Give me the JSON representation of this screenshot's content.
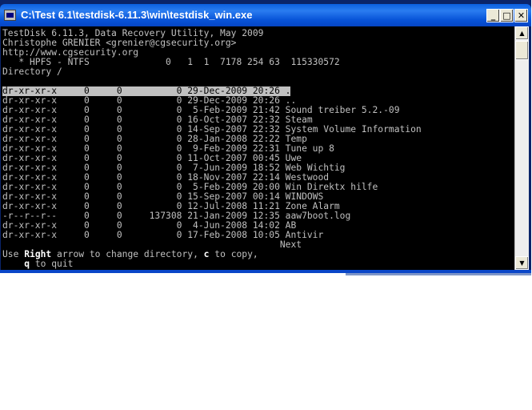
{
  "window": {
    "title": "C:\\Test 6.1\\testdisk-6.11.3\\win\\testdisk_win.exe",
    "controls": {
      "minimize": "_",
      "maximize": "□",
      "close": "✕"
    }
  },
  "console": {
    "header": [
      "TestDisk 6.11.3, Data Recovery Utility, May 2009",
      "Christophe GRENIER <grenier@cgsecurity.org>",
      "http://www.cgsecurity.org",
      "   * HPFS - NTFS              0   1  1  7178 254 63  115330572",
      "Directory /"
    ],
    "rows": [
      "dr-xr-xr-x     0     0          0 29-Dec-2009 20:26 .",
      "dr-xr-xr-x     0     0          0 29-Dec-2009 20:26 ..",
      "dr-xr-xr-x     0     0          0  5-Feb-2009 21:42 Sound treiber 5.2.-09",
      "dr-xr-xr-x     0     0          0 16-Oct-2007 22:32 Steam",
      "dr-xr-xr-x     0     0          0 14-Sep-2007 22:32 System Volume Information",
      "dr-xr-xr-x     0     0          0 28-Jan-2008 22:22 Temp",
      "dr-xr-xr-x     0     0          0  9-Feb-2009 22:31 Tune up 8",
      "dr-xr-xr-x     0     0          0 11-Oct-2007 00:45 Uwe",
      "dr-xr-xr-x     0     0          0  7-Jun-2009 18:52 Web Wichtig",
      "dr-xr-xr-x     0     0          0 18-Nov-2007 22:14 Westwood",
      "dr-xr-xr-x     0     0          0  5-Feb-2009 20:00 Win Direktx hilfe",
      "dr-xr-xr-x     0     0          0 15-Sep-2007 00:14 WINDOWS",
      "dr-xr-xr-x     0     0          0 12-Jul-2008 11:21 Zone Alarm",
      "-r--r--r--     0     0     137308 21-Jan-2009 12:35 aaw7boot.log",
      "dr-xr-xr-x     0     0          0  4-Jun-2008 14:02 AB",
      "dr-xr-xr-x     0     0          0 17-Feb-2008 10:05 Antivir"
    ],
    "selected_row": 0,
    "next_label": "                                                   Next",
    "help": {
      "use": "Use ",
      "right": "Right",
      "mid": " arrow to change directory, ",
      "c": "c",
      "to_copy": " to copy,",
      "indent": "    ",
      "q": "q",
      "to_quit": " to quit"
    }
  },
  "scrollbar": {
    "up_arrow": "▲",
    "down_arrow": "▼"
  }
}
